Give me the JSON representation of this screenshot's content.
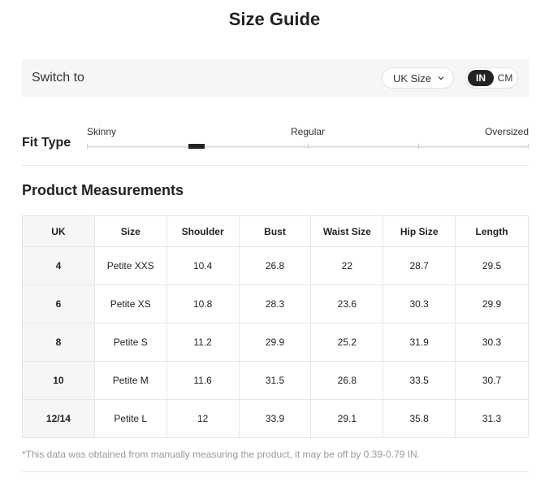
{
  "title": "Size Guide",
  "switch": {
    "label": "Switch to",
    "size_system": "UK Size",
    "units": [
      {
        "label": "IN",
        "selected": true
      },
      {
        "label": "CM",
        "selected": false
      }
    ]
  },
  "fit": {
    "label": "Fit Type",
    "scale": [
      "Skinny",
      "Regular",
      "Oversized"
    ],
    "value_fraction": 0.23
  },
  "measurements": {
    "title": "Product Measurements",
    "columns": [
      "UK",
      "Size",
      "Shoulder",
      "Bust",
      "Waist Size",
      "Hip Size",
      "Length"
    ],
    "rows": [
      [
        "4",
        "Petite XXS",
        "10.4",
        "26.8",
        "22",
        "28.7",
        "29.5"
      ],
      [
        "6",
        "Petite XS",
        "10.8",
        "28.3",
        "23.6",
        "30.3",
        "29.9"
      ],
      [
        "8",
        "Petite S",
        "11.2",
        "29.9",
        "25.2",
        "31.9",
        "30.3"
      ],
      [
        "10",
        "Petite M",
        "11.6",
        "31.5",
        "26.8",
        "33.5",
        "30.7"
      ],
      [
        "12/14",
        "Petite L",
        "12",
        "33.9",
        "29.1",
        "35.8",
        "31.3"
      ]
    ]
  },
  "footnote": "*This data was obtained from manually measuring the product, it may be off by 0.39-0.79 IN.",
  "colors": {
    "accent": "#222222",
    "panel": "#f6f6f6",
    "border": "#e6e6e6",
    "muted": "#999999"
  }
}
